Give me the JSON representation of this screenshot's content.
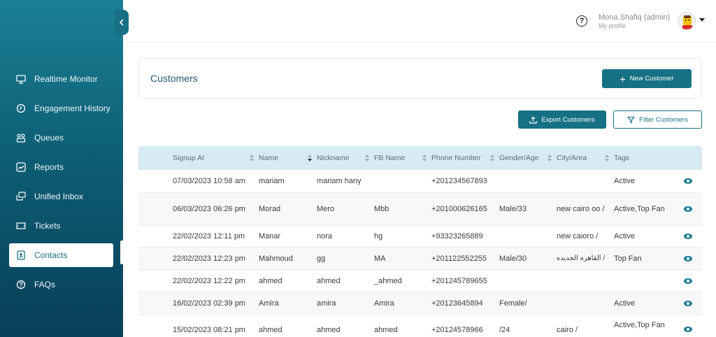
{
  "sidebar": {
    "items": [
      {
        "label": "Realtime Monitor",
        "icon": "monitor-icon",
        "active": false
      },
      {
        "label": "Engagement History",
        "icon": "clock-icon",
        "active": false
      },
      {
        "label": "Queues",
        "icon": "queues-icon",
        "active": false
      },
      {
        "label": "Reports",
        "icon": "chart-icon",
        "active": false
      },
      {
        "label": "Unified Inbox",
        "icon": "inbox-icon",
        "active": false
      },
      {
        "label": "Tickets",
        "icon": "ticket-icon",
        "active": false
      },
      {
        "label": "Contacts",
        "icon": "contact-card-icon",
        "active": true
      },
      {
        "label": "FAQs",
        "icon": "question-icon",
        "active": false
      }
    ]
  },
  "header": {
    "user_name": "Mona Shafiq (admin)",
    "user_sub": "My profile"
  },
  "page": {
    "title": "Customers",
    "new_button": "New Customer",
    "export_button": "Export Customers",
    "filter_button": "Filter Customers"
  },
  "table": {
    "columns": [
      "Signup At",
      "Name",
      "Nickname",
      "FB Name",
      "Phone Number",
      "Gender/Age",
      "City/Area",
      "Tags"
    ],
    "rows": [
      [
        "07/03/2023 10:58 am",
        "mariam",
        "mariam hany",
        "",
        "+201234567893",
        "",
        "",
        "Active"
      ],
      [
        "06/03/2023 06:26 pm",
        "Morad",
        "Mero",
        "Mbb",
        "+201000626165",
        "Male/33",
        "new cairo oo /",
        "Active,Top Fan"
      ],
      [
        "22/02/2023 12:11 pm",
        "Manar",
        "nora",
        "hg",
        "+93323265889",
        "",
        "new caioro /",
        "Active"
      ],
      [
        "22/02/2023 12:23 pm",
        "Mahmoud",
        "gg",
        "MA",
        "+201122552255",
        "Male/30",
        "القاهره الجديده /",
        "Top Fan"
      ],
      [
        "22/02/2023 12:22 pm",
        "ahmed",
        "ahmed",
        "_ahmed",
        "+201245789655",
        "",
        "",
        ""
      ],
      [
        "16/02/2023 02:39 pm",
        "Amira",
        "amira",
        "Amira",
        "+20123645894",
        "Female/",
        "",
        "Active"
      ],
      [
        "15/02/2023 08:21 pm",
        "ahmed",
        "ahmed",
        "ahmed",
        "+20124578966",
        "/24",
        "cairo /",
        "Active,Top Fan"
      ]
    ]
  },
  "colors": {
    "accent": "#177184",
    "sidebar_top": "#1b8095",
    "sidebar_bottom": "#083f58",
    "table_header": "#d6ebf2"
  }
}
